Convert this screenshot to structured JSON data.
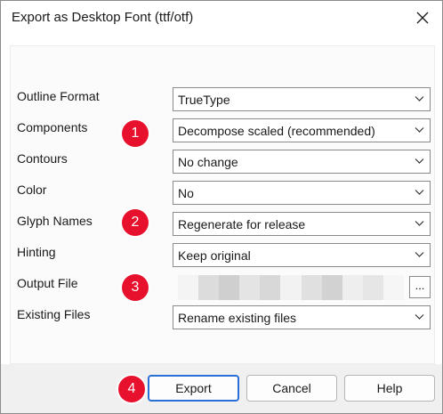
{
  "window": {
    "title": "Export as Desktop Font (ttf/otf)"
  },
  "fields": [
    {
      "label": "Outline Format",
      "value": "TrueType"
    },
    {
      "label": "Components",
      "value": "Decompose scaled (recommended)"
    },
    {
      "label": "Contours",
      "value": "No change"
    },
    {
      "label": "Color",
      "value": "No"
    },
    {
      "label": "Glyph Names",
      "value": "Regenerate for release"
    },
    {
      "label": "Hinting",
      "value": "Keep original"
    },
    {
      "label": "Output File",
      "value": ""
    },
    {
      "label": "Existing Files",
      "value": "Rename existing files"
    }
  ],
  "browse_label": "...",
  "badges": [
    "1",
    "2",
    "3",
    "4"
  ],
  "buttons": {
    "export": "Export",
    "cancel": "Cancel",
    "help": "Help"
  },
  "colors": {
    "badge": "#e8112d",
    "primary_border": "#2a6fd6"
  }
}
